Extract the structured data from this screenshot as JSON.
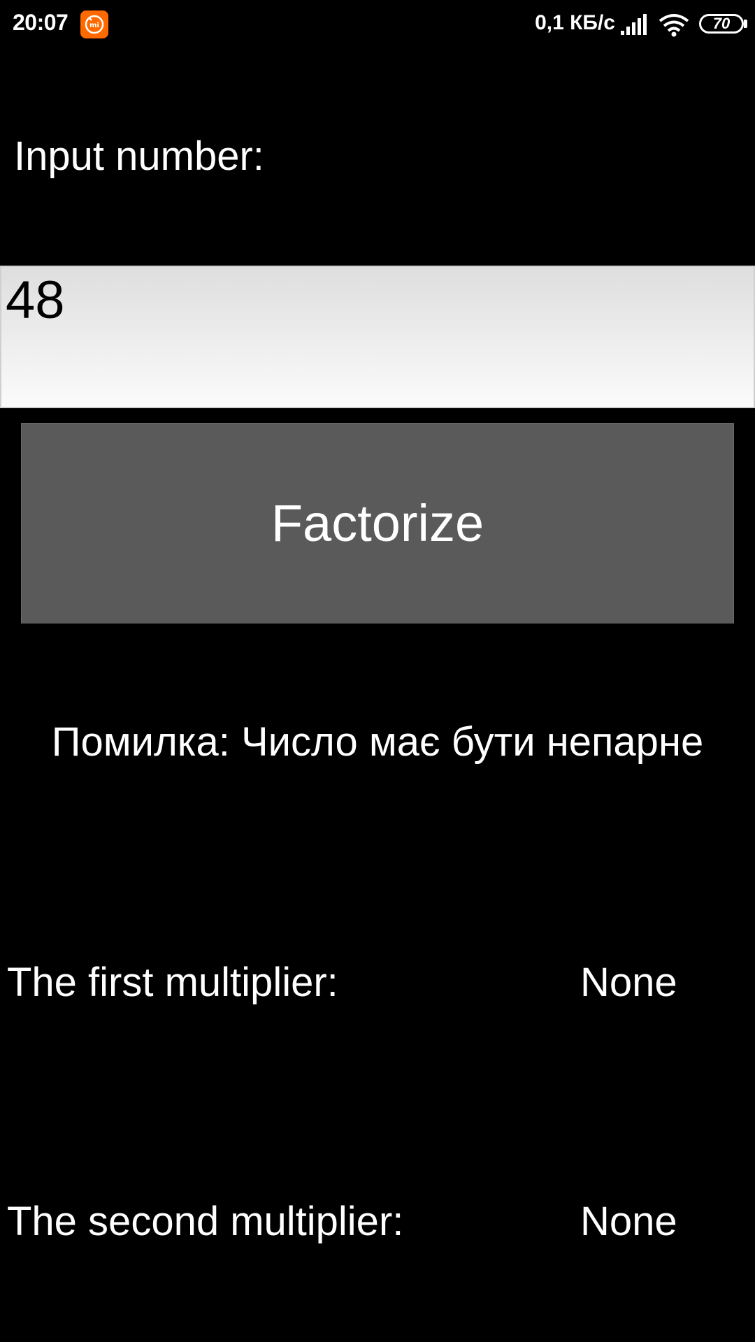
{
  "status_bar": {
    "time": "20:07",
    "app_badge_icon": "mi-icon",
    "network_speed": "0,1 КБ/с",
    "signal_icon": "cellular-signal-icon",
    "wifi_icon": "wifi-icon",
    "battery_level": "70",
    "accent_color": "#ff6a00"
  },
  "form": {
    "input_label": "Input number:",
    "input_value": "48",
    "button_label": "Factorize"
  },
  "result": {
    "error_message": "Помилка: Число має бути непарне",
    "first_label": "The first multiplier:",
    "first_value": "None",
    "second_label": "The second multiplier:",
    "second_value": "None"
  }
}
